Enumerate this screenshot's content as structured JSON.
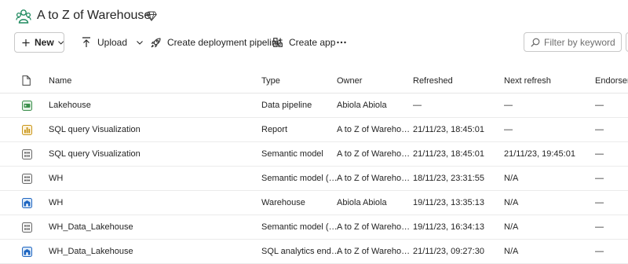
{
  "workspace": {
    "title": "A to Z of Warehouse",
    "icon": "workspace-people-icon",
    "badge_icon": "premium-diamond-icon"
  },
  "toolbar": {
    "new_label": "New",
    "upload_label": "Upload",
    "pipeline_label": "Create deployment pipeline",
    "app_label": "Create app",
    "more_label": "···",
    "filter_placeholder": "Filter by keyword"
  },
  "table": {
    "columns": [
      "Name",
      "Type",
      "Owner",
      "Refreshed",
      "Next refresh",
      "Endorsement"
    ],
    "rows": [
      {
        "icon": "data-pipeline-icon",
        "name": "Lakehouse",
        "type": "Data pipeline",
        "owner": "Abiola Abiola",
        "refreshed": "—",
        "next_refresh": "—",
        "endorsement": "—"
      },
      {
        "icon": "report-icon",
        "name": "SQL query Visualization",
        "type": "Report",
        "owner": "A to Z of Wareho…",
        "refreshed": "21/11/23, 18:45:01",
        "next_refresh": "—",
        "endorsement": "—"
      },
      {
        "icon": "semantic-model-icon",
        "name": "SQL query Visualization",
        "type": "Semantic model",
        "owner": "A to Z of Wareho…",
        "refreshed": "21/11/23, 18:45:01",
        "next_refresh": "21/11/23, 19:45:01",
        "endorsement": "—"
      },
      {
        "icon": "semantic-model-icon",
        "name": "WH",
        "type": "Semantic model (…",
        "owner": "A to Z of Wareho…",
        "refreshed": "18/11/23, 23:31:55",
        "next_refresh": "N/A",
        "endorsement": "—"
      },
      {
        "icon": "warehouse-icon",
        "name": "WH",
        "type": "Warehouse",
        "owner": "Abiola Abiola",
        "refreshed": "19/11/23, 13:35:13",
        "next_refresh": "N/A",
        "endorsement": "—"
      },
      {
        "icon": "semantic-model-icon",
        "name": "WH_Data_Lakehouse",
        "type": "Semantic model (…",
        "owner": "A to Z of Wareho…",
        "refreshed": "19/11/23, 16:34:13",
        "next_refresh": "N/A",
        "endorsement": "—"
      },
      {
        "icon": "sql-endpoint-icon",
        "name": "WH_Data_Lakehouse",
        "type": "SQL analytics end…",
        "owner": "A to Z of Wareho…",
        "refreshed": "21/11/23, 09:27:30",
        "next_refresh": "N/A",
        "endorsement": "—"
      }
    ]
  }
}
